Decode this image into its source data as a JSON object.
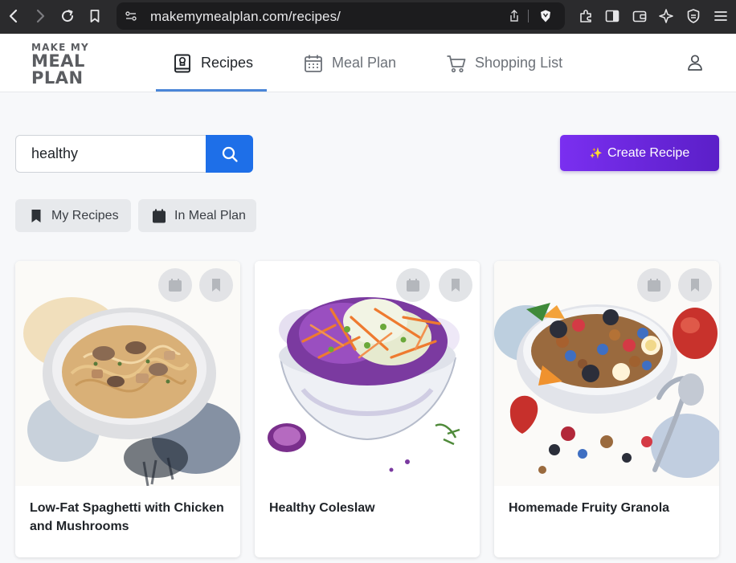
{
  "browser": {
    "url": "makemymealplan.com/recipes/"
  },
  "header": {
    "logo_line1": "MAKE MY",
    "logo_line2": "MEAL",
    "logo_line3": "PLAN",
    "tabs": [
      {
        "label": "Recipes",
        "icon": "recipe-book-icon",
        "active": true
      },
      {
        "label": "Meal Plan",
        "icon": "calendar-icon",
        "active": false
      },
      {
        "label": "Shopping List",
        "icon": "cart-icon",
        "active": false
      }
    ],
    "active_tab_color": "#4a86d8"
  },
  "search": {
    "value": "healthy",
    "button_color": "#1e6fe8"
  },
  "create_button": {
    "label": "Create Recipe",
    "icon": "sparkle-icon",
    "color": "#7a2ff0"
  },
  "filters": [
    {
      "label": "My Recipes",
      "icon": "bookmark-icon"
    },
    {
      "label": "In Meal Plan",
      "icon": "calendar-icon"
    }
  ],
  "recipes": [
    {
      "title": "Low-Fat Spaghetti with Chicken and Mushrooms",
      "image": "spaghetti-bowl-watercolor"
    },
    {
      "title": "Healthy Coleslaw",
      "image": "coleslaw-bowl-watercolor"
    },
    {
      "title": "Homemade Fruity Granola",
      "image": "granola-bowl-watercolor"
    }
  ]
}
